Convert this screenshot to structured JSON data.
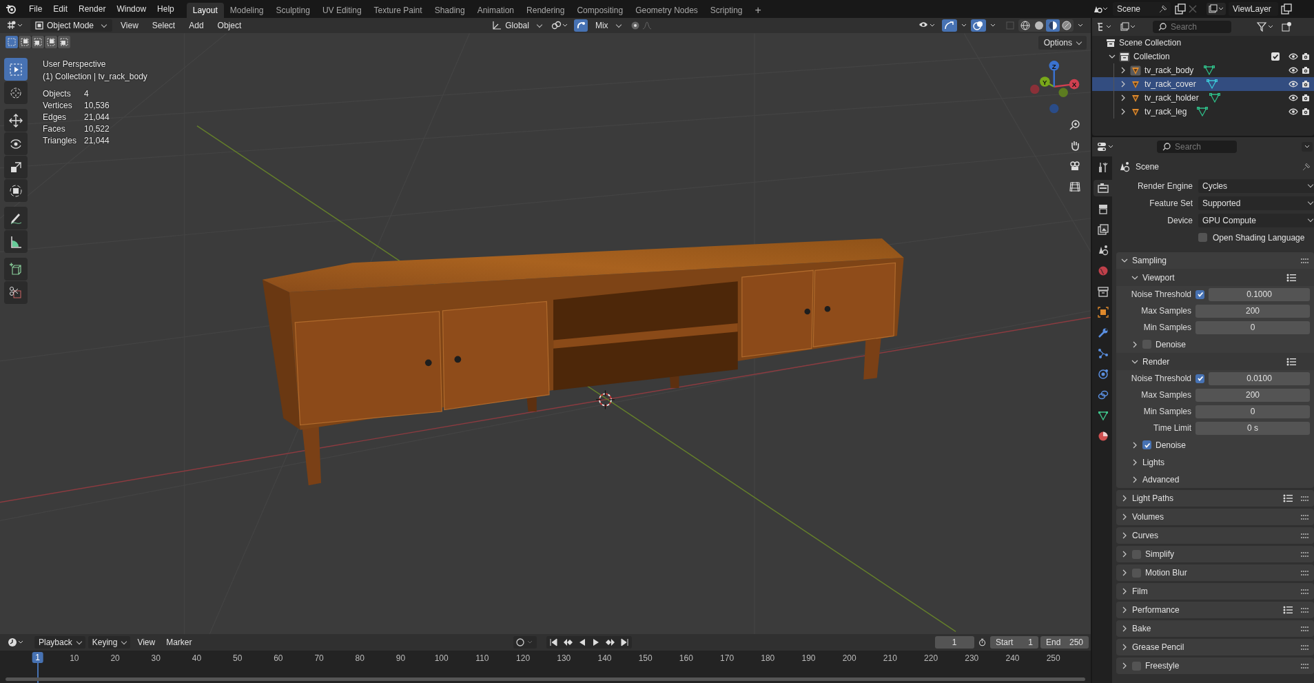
{
  "topbar": {
    "menus": [
      "File",
      "Edit",
      "Render",
      "Window",
      "Help"
    ],
    "workspaces": [
      {
        "label": "Layout",
        "selected": true
      },
      {
        "label": "Modeling",
        "selected": false
      },
      {
        "label": "Sculpting",
        "selected": false
      },
      {
        "label": "UV Editing",
        "selected": false
      },
      {
        "label": "Texture Paint",
        "selected": false
      },
      {
        "label": "Shading",
        "selected": false
      },
      {
        "label": "Animation",
        "selected": false
      },
      {
        "label": "Rendering",
        "selected": false
      },
      {
        "label": "Compositing",
        "selected": false
      },
      {
        "label": "Geometry Nodes",
        "selected": false
      },
      {
        "label": "Scripting",
        "selected": false
      }
    ],
    "add_workspace": "+",
    "scene": "Scene",
    "view_layer": "ViewLayer"
  },
  "viewport": {
    "mode": "Object Mode",
    "menus": [
      "View",
      "Select",
      "Add",
      "Object"
    ],
    "orientation": "Global",
    "snap_target": "Mix",
    "options": "Options",
    "select_modes": [
      {
        "selected": true
      },
      {
        "selected": false
      },
      {
        "selected": false
      },
      {
        "selected": false
      },
      {
        "selected": false
      }
    ],
    "title": "User Perspective",
    "context": "(1) Collection | tv_rack_body",
    "stats": [
      {
        "label": "Objects",
        "value": "4"
      },
      {
        "label": "Vertices",
        "value": "10,536"
      },
      {
        "label": "Edges",
        "value": "21,044"
      },
      {
        "label": "Faces",
        "value": "10,522"
      },
      {
        "label": "Triangles",
        "value": "21,044"
      }
    ],
    "tools": [
      {
        "kind": "select_box",
        "selected": true
      },
      {
        "kind": "cursor",
        "selected": false
      },
      {
        "kind": "move",
        "selected": false
      },
      {
        "kind": "rotate",
        "selected": false
      },
      {
        "kind": "scale",
        "selected": false
      },
      {
        "kind": "transform",
        "selected": false
      },
      {
        "kind": "annotate",
        "selected": false
      },
      {
        "kind": "measure",
        "selected": false
      },
      {
        "kind": "add_cube",
        "selected": false
      },
      {
        "kind": "cut",
        "selected": false
      }
    ],
    "gizmo": {
      "axes": [
        "Z",
        "Y",
        "X"
      ]
    }
  },
  "outliner": {
    "search": {
      "placeholder": "Search"
    },
    "root": "Scene Collection",
    "tree": [
      {
        "label": "Collection",
        "expanded": true,
        "checked": true,
        "children": [
          {
            "label": "tv_rack_body",
            "expanded": false,
            "active": true,
            "selected": false
          },
          {
            "label": "tv_rack_cover",
            "expanded": false,
            "active": false,
            "selected": true
          },
          {
            "label": "tv_rack_holder",
            "expanded": false,
            "active": false,
            "selected": false
          },
          {
            "label": "tv_rack_leg",
            "expanded": false,
            "active": false,
            "selected": false
          }
        ]
      }
    ]
  },
  "properties": {
    "search": {
      "placeholder": "Search"
    },
    "tabs": [
      {
        "kind": "tool",
        "selected": false
      },
      {
        "kind": "render",
        "selected": true
      },
      {
        "kind": "output",
        "selected": false
      },
      {
        "kind": "view_layer",
        "selected": false
      },
      {
        "kind": "scene",
        "selected": false
      },
      {
        "kind": "world",
        "selected": false
      },
      {
        "kind": "collection",
        "selected": false
      },
      {
        "kind": "object",
        "selected": false
      },
      {
        "kind": "modifiers",
        "selected": false
      },
      {
        "kind": "particles",
        "selected": false
      },
      {
        "kind": "physics",
        "selected": false
      },
      {
        "kind": "constraints",
        "selected": false
      },
      {
        "kind": "data",
        "selected": false
      },
      {
        "kind": "material",
        "selected": false
      }
    ],
    "context": "Scene",
    "fields": [
      {
        "label": "Render Engine",
        "value": "Cycles"
      },
      {
        "label": "Feature Set",
        "value": "Supported"
      },
      {
        "label": "Device",
        "value": "GPU Compute"
      }
    ],
    "osl": {
      "label": "Open Shading Language",
      "checked": false
    },
    "sampling": {
      "label": "Sampling",
      "expanded": true,
      "rows": [
        {
          "kind": "subheader",
          "label": "Viewport",
          "expanded": true,
          "presets": true
        },
        {
          "kind": "number",
          "label": "Noise Threshold",
          "value": "0.1000",
          "checked": true
        },
        {
          "kind": "number",
          "label": "Max Samples",
          "value": "200"
        },
        {
          "kind": "number",
          "label": "Min Samples",
          "value": "0"
        },
        {
          "kind": "subheader",
          "label": "Denoise",
          "expanded": false,
          "checked": false
        },
        {
          "kind": "subheader",
          "label": "Render",
          "expanded": true,
          "presets": true
        },
        {
          "kind": "number",
          "label": "Noise Threshold",
          "value": "0.0100",
          "checked": true
        },
        {
          "kind": "number",
          "label": "Max Samples",
          "value": "200"
        },
        {
          "kind": "number",
          "label": "Min Samples",
          "value": "0"
        },
        {
          "kind": "number",
          "label": "Time Limit",
          "value": "0 s"
        },
        {
          "kind": "subheader",
          "label": "Denoise",
          "expanded": false,
          "checked": true
        },
        {
          "kind": "subheader",
          "label": "Lights",
          "expanded": false
        },
        {
          "kind": "subheader",
          "label": "Advanced",
          "expanded": false
        }
      ]
    },
    "panels": [
      {
        "label": "Light Paths",
        "expanded": false,
        "presets": true
      },
      {
        "label": "Volumes",
        "expanded": false
      },
      {
        "label": "Curves",
        "expanded": false
      },
      {
        "label": "Simplify",
        "expanded": false,
        "checked": false
      },
      {
        "label": "Motion Blur",
        "expanded": false,
        "checked": false
      },
      {
        "label": "Film",
        "expanded": false
      },
      {
        "label": "Performance",
        "expanded": false,
        "presets": true
      },
      {
        "label": "Bake",
        "expanded": false
      },
      {
        "label": "Grease Pencil",
        "expanded": false
      },
      {
        "label": "Freestyle",
        "expanded": false,
        "checked": false
      }
    ]
  },
  "timeline": {
    "menus": [
      "Playback",
      "Keying",
      "View",
      "Marker"
    ],
    "current_frame": "1",
    "start": {
      "label": "Start",
      "value": "1"
    },
    "end": {
      "label": "End",
      "value": "250"
    },
    "playhead": "1",
    "ticks": [
      "10",
      "20",
      "30",
      "40",
      "50",
      "60",
      "70",
      "80",
      "90",
      "100",
      "110",
      "120",
      "130",
      "140",
      "150",
      "160",
      "170",
      "180",
      "190",
      "200",
      "210",
      "220",
      "230",
      "240",
      "250"
    ]
  }
}
